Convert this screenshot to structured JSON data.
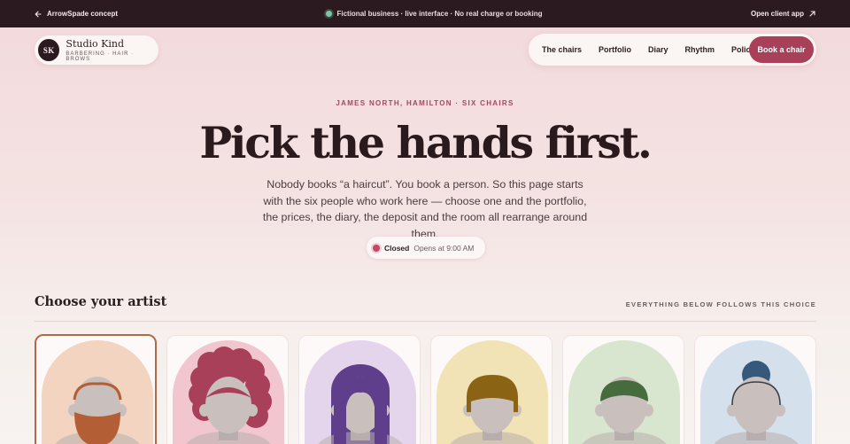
{
  "topbar": {
    "back_label": "ArrowSpade concept",
    "notice": "Fictional business · live interface · No real charge or booking",
    "client_app_label": "Open client app"
  },
  "brand": {
    "monogram": "SK",
    "name": "Studio Kind",
    "tagline": "BARBERING · HAIR · BROWS"
  },
  "nav": {
    "items": [
      "The chairs",
      "Portfolio",
      "Diary",
      "Rhythm",
      "Policy"
    ],
    "cta": "Book a chair"
  },
  "hero": {
    "eyebrow": "JAMES NORTH, HAMILTON · SIX CHAIRS",
    "headline": "Pick the hands first.",
    "subtext": "Nobody books “a haircut”. You book a person. So this page starts with the six people who work here — choose one and the portfolio, the prices, the diary, the deposit and the room all rearrange around them.",
    "status_label": "Closed",
    "status_detail": "Opens at 9:00 AM"
  },
  "artists": {
    "title": "Choose your artist",
    "note": "EVERYTHING BELOW FOLLOWS THIS CHOICE",
    "selected_index": 0,
    "cards": [
      {
        "arch_color": "#f2d4c0",
        "hair_color": "#b35e34",
        "style": "beard"
      },
      {
        "arch_color": "#f1c6cf",
        "hair_color": "#a8405a",
        "style": "curls"
      },
      {
        "arch_color": "#e4d4ec",
        "hair_color": "#5f3f8c",
        "style": "long"
      },
      {
        "arch_color": "#f1e3b5",
        "hair_color": "#8a6414",
        "style": "bob"
      },
      {
        "arch_color": "#d9e6cf",
        "hair_color": "#466b3c",
        "style": "short"
      },
      {
        "arch_color": "#d4e0ec",
        "hair_color": "#36587a",
        "style": "bun"
      }
    ]
  },
  "colors": {
    "accent": "#a8405a",
    "topbar_bg": "#2b1a20",
    "status_dot": "#c04a65",
    "open_dot": "#7fc4a6"
  }
}
